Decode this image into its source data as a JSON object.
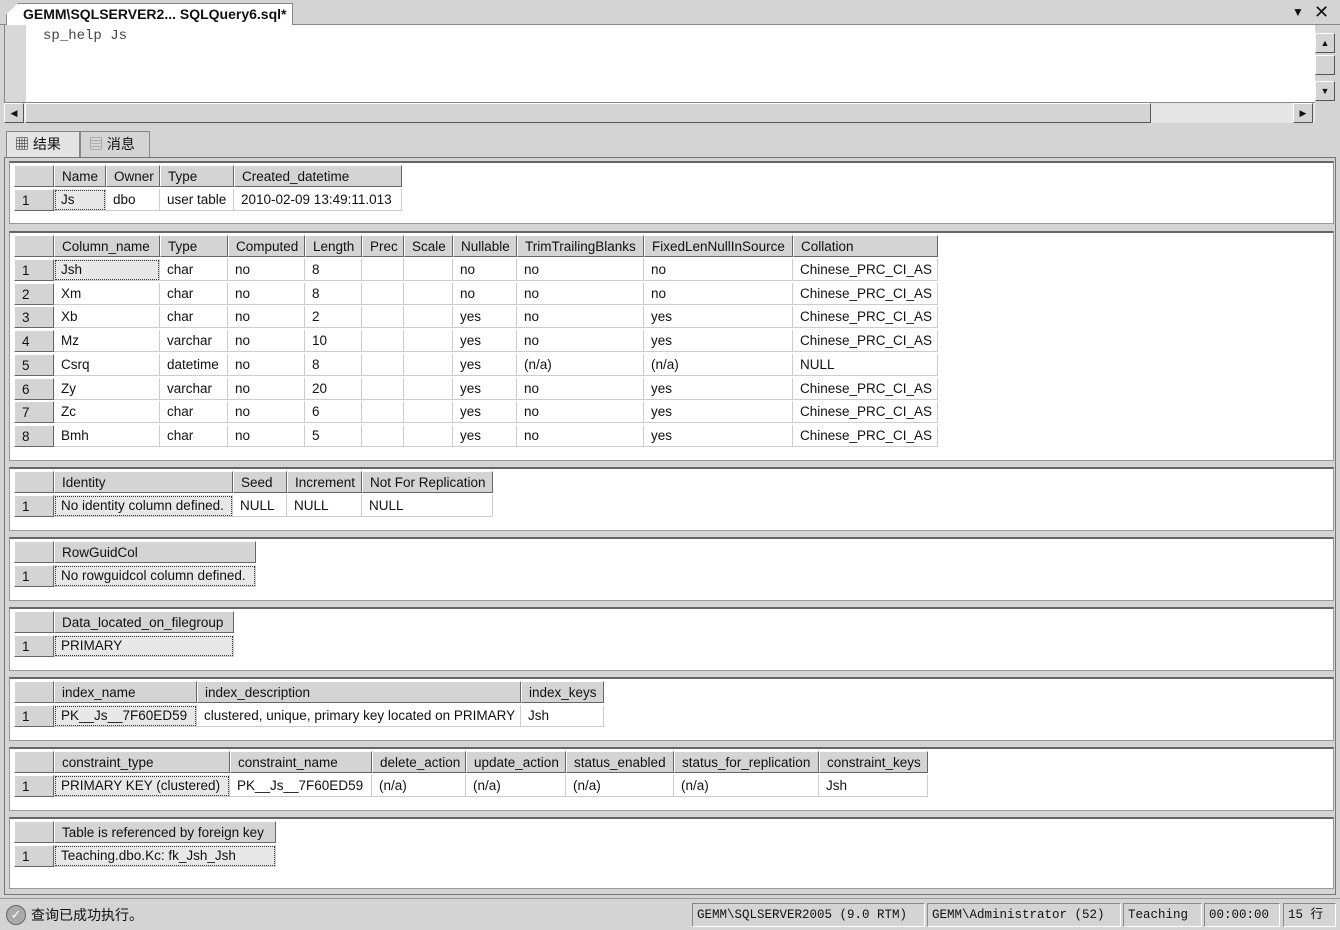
{
  "document_tab": {
    "title": "GEMM\\SQLSERVER2... SQLQuery6.sql*"
  },
  "editor": {
    "text": "sp_help Js"
  },
  "results_tabs": [
    {
      "label": "结果",
      "icon": "grid-icon"
    },
    {
      "label": "消息",
      "icon": "messages-icon"
    }
  ],
  "grids": [
    {
      "columns": [
        "Name",
        "Owner",
        "Type",
        "Created_datetime"
      ],
      "rows": [
        [
          "Js",
          "dbo",
          "user table",
          "2010-02-09 13:49:11.013"
        ]
      ]
    },
    {
      "columns": [
        "Column_name",
        "Type",
        "Computed",
        "Length",
        "Prec",
        "Scale",
        "Nullable",
        "TrimTrailingBlanks",
        "FixedLenNullInSource",
        "Collation"
      ],
      "rows": [
        [
          "Jsh",
          "char",
          "no",
          "8",
          "",
          "",
          "no",
          "no",
          "no",
          "Chinese_PRC_CI_AS"
        ],
        [
          "Xm",
          "char",
          "no",
          "8",
          "",
          "",
          "no",
          "no",
          "no",
          "Chinese_PRC_CI_AS"
        ],
        [
          "Xb",
          "char",
          "no",
          "2",
          "",
          "",
          "yes",
          "no",
          "yes",
          "Chinese_PRC_CI_AS"
        ],
        [
          "Mz",
          "varchar",
          "no",
          "10",
          "",
          "",
          "yes",
          "no",
          "yes",
          "Chinese_PRC_CI_AS"
        ],
        [
          "Csrq",
          "datetime",
          "no",
          "8",
          "",
          "",
          "yes",
          "(n/a)",
          "(n/a)",
          "NULL"
        ],
        [
          "Zy",
          "varchar",
          "no",
          "20",
          "",
          "",
          "yes",
          "no",
          "yes",
          "Chinese_PRC_CI_AS"
        ],
        [
          "Zc",
          "char",
          "no",
          "6",
          "",
          "",
          "yes",
          "no",
          "yes",
          "Chinese_PRC_CI_AS"
        ],
        [
          "Bmh",
          "char",
          "no",
          "5",
          "",
          "",
          "yes",
          "no",
          "yes",
          "Chinese_PRC_CI_AS"
        ]
      ]
    },
    {
      "columns": [
        "Identity",
        "Seed",
        "Increment",
        "Not For Replication"
      ],
      "rows": [
        [
          "No identity column defined.",
          "NULL",
          "NULL",
          "NULL"
        ]
      ]
    },
    {
      "columns": [
        "RowGuidCol"
      ],
      "rows": [
        [
          "No rowguidcol column defined."
        ]
      ]
    },
    {
      "columns": [
        "Data_located_on_filegroup"
      ],
      "rows": [
        [
          "PRIMARY"
        ]
      ]
    },
    {
      "columns": [
        "index_name",
        "index_description",
        "index_keys"
      ],
      "rows": [
        [
          "PK__Js__7F60ED59",
          "clustered, unique, primary key located on PRIMARY",
          "Jsh"
        ]
      ]
    },
    {
      "columns": [
        "constraint_type",
        "constraint_name",
        "delete_action",
        "update_action",
        "status_enabled",
        "status_for_replication",
        "constraint_keys"
      ],
      "rows": [
        [
          "PRIMARY KEY (clustered)",
          "PK__Js__7F60ED59",
          "(n/a)",
          "(n/a)",
          "(n/a)",
          "(n/a)",
          "Jsh"
        ]
      ]
    },
    {
      "columns": [
        "Table is referenced by foreign key"
      ],
      "rows": [
        [
          "Teaching.dbo.Kc: fk_Jsh_Jsh"
        ]
      ]
    }
  ],
  "statusbar": {
    "message": "查询已成功执行。",
    "server": "GEMM\\SQLSERVER2005 (9.0 RTM)",
    "user": "GEMM\\Administrator (52)",
    "database": "Teaching",
    "elapsed": "00:00:00",
    "rows": "15 行"
  }
}
